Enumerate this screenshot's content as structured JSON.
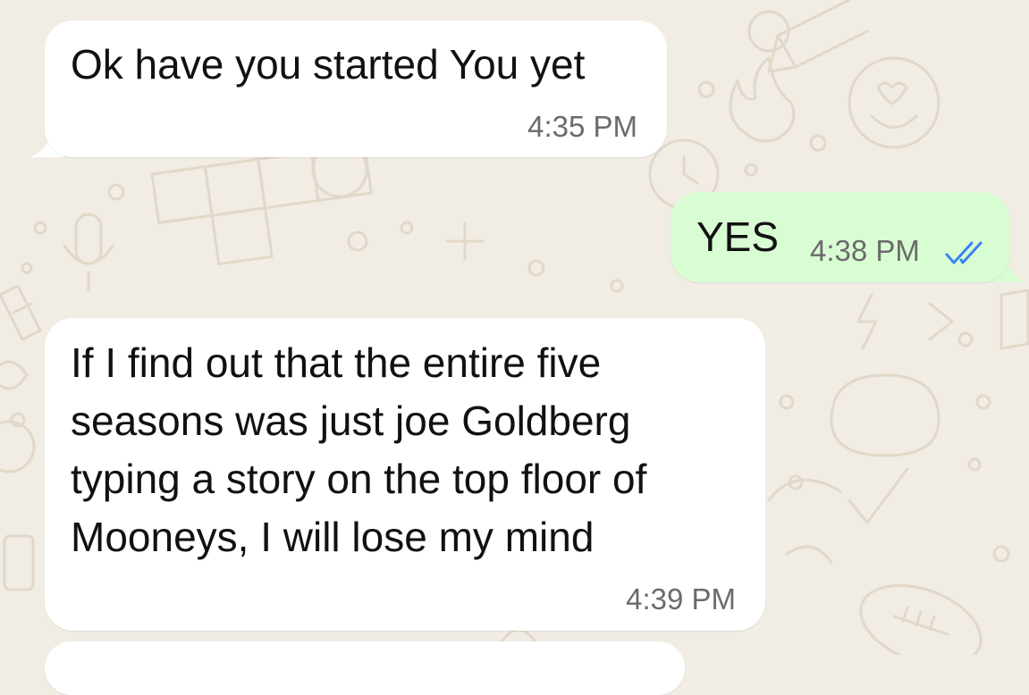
{
  "chat": {
    "messages": [
      {
        "direction": "incoming",
        "text": "Ok have you started You yet",
        "time": "4:35 PM"
      },
      {
        "direction": "outgoing",
        "text": "YES",
        "time": "4:38 PM",
        "status_icon": "double-check-read-icon"
      },
      {
        "direction": "incoming",
        "text": "If I find out that the entire five\nseasons was just joe Goldberg\ntyping a story on the top floor of\nMooneys, I will lose my mind",
        "time": "4:39 PM"
      }
    ]
  },
  "colors": {
    "wallpaper_bg": "#f1ece4",
    "wallpaper_doodle": "#e2d8c9",
    "incoming_bubble": "#ffffff",
    "outgoing_bubble": "#d9fdd3",
    "message_text": "#111111",
    "timestamp": "#6b6b6b",
    "read_receipt": "#3b82f6"
  }
}
